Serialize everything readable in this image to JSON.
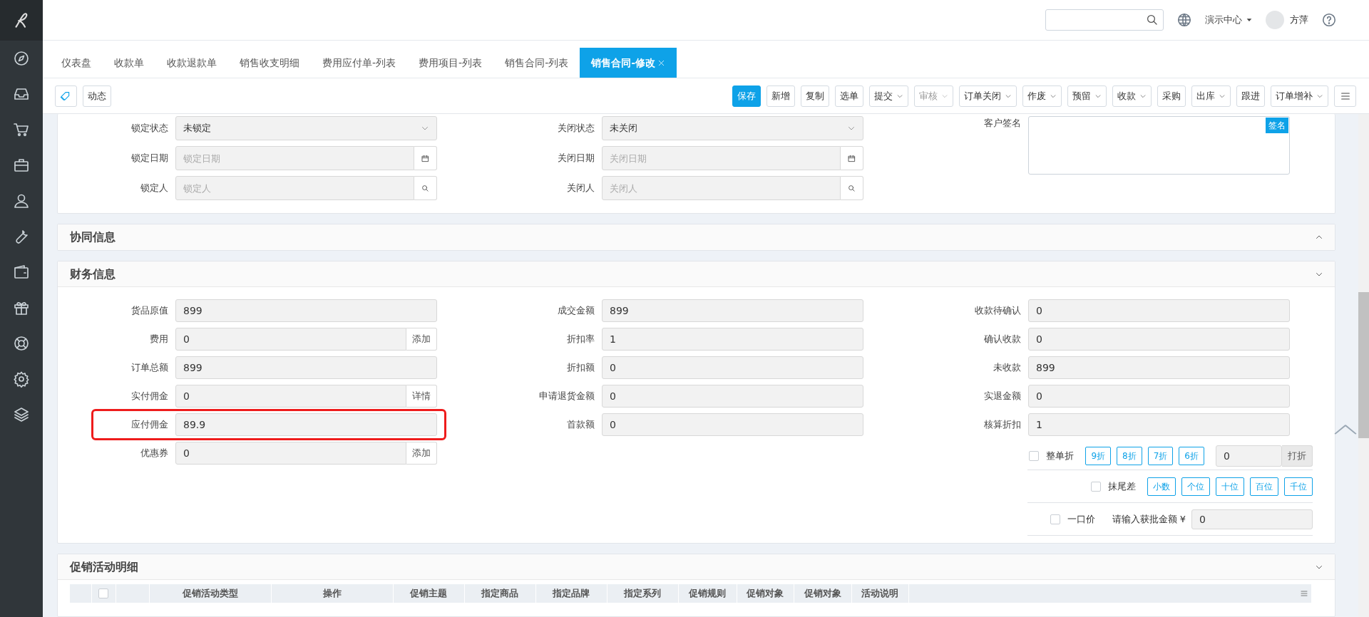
{
  "header": {
    "org": "演示中心",
    "user": "方萍"
  },
  "tabs": [
    {
      "label": "仪表盘",
      "selected": false
    },
    {
      "label": "收款单",
      "selected": false
    },
    {
      "label": "收款退款单",
      "selected": false
    },
    {
      "label": "销售收支明细",
      "selected": false
    },
    {
      "label": "费用应付单-列表",
      "selected": false
    },
    {
      "label": "费用项目-列表",
      "selected": false
    },
    {
      "label": "销售合同-列表",
      "selected": false
    },
    {
      "label": "销售合同-修改",
      "selected": true
    }
  ],
  "toolbar": {
    "left": [
      {
        "kind": "icon"
      },
      {
        "kind": "text",
        "label": "动态"
      }
    ],
    "right": [
      {
        "label": "保存",
        "primary": true,
        "dropdown": false,
        "disabled": false
      },
      {
        "label": "新增",
        "primary": false,
        "dropdown": false,
        "disabled": false
      },
      {
        "label": "复制",
        "primary": false,
        "dropdown": false,
        "disabled": false
      },
      {
        "label": "选单",
        "primary": false,
        "dropdown": false,
        "disabled": false
      },
      {
        "label": "提交",
        "primary": false,
        "dropdown": true,
        "disabled": false
      },
      {
        "label": "审核",
        "primary": false,
        "dropdown": true,
        "disabled": true
      },
      {
        "label": "订单关闭",
        "primary": false,
        "dropdown": true,
        "disabled": false
      },
      {
        "label": "作废",
        "primary": false,
        "dropdown": true,
        "disabled": false
      },
      {
        "label": "预留",
        "primary": false,
        "dropdown": true,
        "disabled": false
      },
      {
        "label": "收款",
        "primary": false,
        "dropdown": true,
        "disabled": false
      },
      {
        "label": "采购",
        "primary": false,
        "dropdown": false,
        "disabled": false
      },
      {
        "label": "出库",
        "primary": false,
        "dropdown": true,
        "disabled": false
      },
      {
        "label": "跟进",
        "primary": false,
        "dropdown": false,
        "disabled": false
      },
      {
        "label": "订单增补",
        "primary": false,
        "dropdown": true,
        "disabled": false
      }
    ]
  },
  "lock_panel": {
    "columns": [
      [
        {
          "label": "锁定状态",
          "kind": "select",
          "value": "未锁定"
        },
        {
          "label": "锁定日期",
          "kind": "date",
          "placeholder": "锁定日期"
        },
        {
          "label": "锁定人",
          "kind": "lookup",
          "placeholder": "锁定人"
        }
      ],
      [
        {
          "label": "关闭状态",
          "kind": "select",
          "value": "未关闭"
        },
        {
          "label": "关闭日期",
          "kind": "date",
          "placeholder": "关闭日期"
        },
        {
          "label": "关闭人",
          "kind": "lookup",
          "placeholder": "关闭人"
        }
      ],
      [
        {
          "label": "客户签名",
          "kind": "signature",
          "button": "签名"
        }
      ]
    ]
  },
  "sections": [
    {
      "title": "协同信息",
      "expanded": false
    },
    {
      "title": "财务信息",
      "expanded": true
    }
  ],
  "finance": {
    "columns": [
      [
        {
          "label": "货品原值",
          "value": "899"
        },
        {
          "label": "费用",
          "value": "0",
          "addon": "添加"
        },
        {
          "label": "订单总额",
          "value": "899"
        },
        {
          "label": "实付佣金",
          "value": "0",
          "addon": "详情"
        },
        {
          "label": "应付佣金",
          "value": "89.9",
          "highlight": true
        },
        {
          "label": "优惠券",
          "value": "0",
          "addon": "添加"
        }
      ],
      [
        {
          "label": "成交金额",
          "value": "899"
        },
        {
          "label": "折扣率",
          "value": "1"
        },
        {
          "label": "折扣额",
          "value": "0"
        },
        {
          "label": "申请退货金额",
          "value": "0"
        },
        {
          "label": "首款额",
          "value": "0"
        }
      ],
      [
        {
          "label": "收款待确认",
          "value": "0"
        },
        {
          "label": "确认收款",
          "value": "0"
        },
        {
          "label": "未收款",
          "value": "899"
        },
        {
          "label": "实退金额",
          "value": "0"
        },
        {
          "label": "核算折扣",
          "value": "1"
        }
      ]
    ],
    "discount_rows": [
      {
        "kind": "buttons",
        "label": "整单折",
        "checked": false,
        "buttons": [
          "9折",
          "8折",
          "7折",
          "6折"
        ],
        "value": "0",
        "action": "打折"
      },
      {
        "kind": "buttons",
        "label": "抹尾差",
        "checked": false,
        "buttons": [
          "小数",
          "个位",
          "十位",
          "百位",
          "千位"
        ]
      },
      {
        "kind": "amount",
        "label": "一口价",
        "checked": false,
        "prompt": "请输入获批金额 ¥",
        "value": "0"
      }
    ]
  },
  "promo": {
    "title": "促销活动明细",
    "expanded": true,
    "select_all_checked": false,
    "columns": [
      "促销活动类型",
      "操作",
      "促销主题",
      "指定商品",
      "指定品牌",
      "指定系列",
      "促销规则",
      "促销对象",
      "促销对象",
      "活动说明"
    ]
  }
}
